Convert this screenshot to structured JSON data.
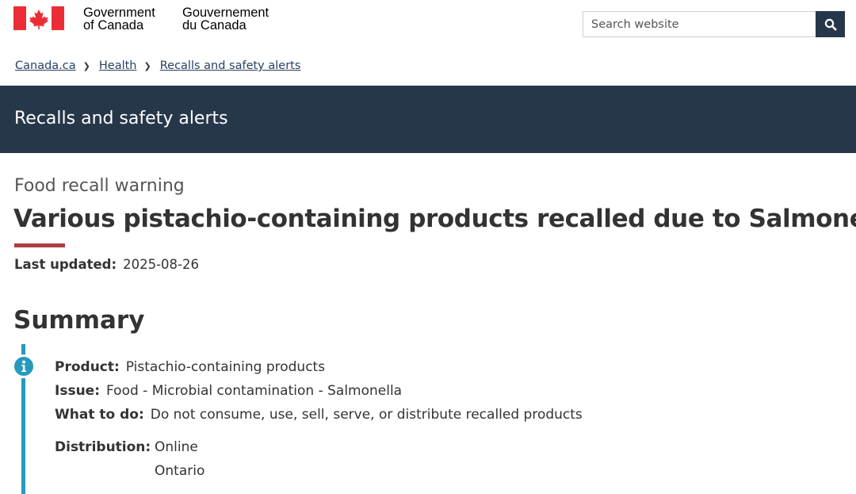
{
  "header": {
    "signature_en_line1": "Government",
    "signature_en_line2": "of Canada",
    "signature_fr_line1": "Gouvernement",
    "signature_fr_line2": "du Canada",
    "search_placeholder": "Search website",
    "search_icon": "search-icon",
    "flag_color": "#eb2d37"
  },
  "breadcrumb": [
    {
      "label": "Canada.ca"
    },
    {
      "label": "Health"
    },
    {
      "label": "Recalls and safety alerts"
    }
  ],
  "banner": {
    "title": "Recalls and safety alerts",
    "background": "#26374a"
  },
  "page": {
    "eyebrow": "Food recall warning",
    "title": "Various pistachio-containing products recalled due to Salmonella",
    "title_rule_color": "#af3c43",
    "last_updated_label": "Last updated:",
    "last_updated_value": "2025-08-26"
  },
  "summary": {
    "heading": "Summary",
    "accent_color": "#269abc",
    "product_label": "Product:",
    "product_value": "Pistachio-containing products",
    "issue_label": "Issue:",
    "issue_value": "Food - Microbial contamination - Salmonella",
    "what_label": "What to do:",
    "what_value": "Do not consume, use, sell, serve, or distribute recalled products",
    "distribution_label": "Distribution:",
    "distribution_values": [
      "Online",
      "Ontario"
    ]
  }
}
